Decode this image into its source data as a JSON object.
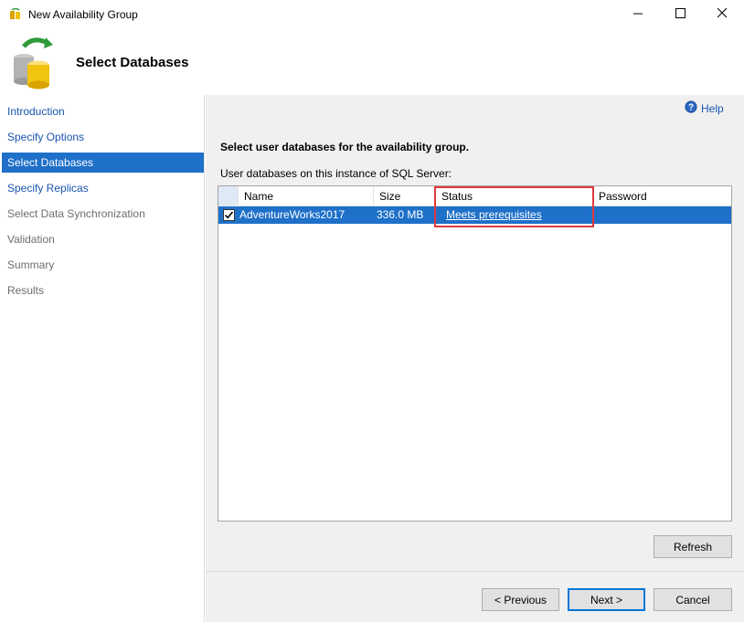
{
  "window": {
    "title": "New Availability Group",
    "controls": [
      "minimize-icon",
      "maximize-icon",
      "close-icon"
    ]
  },
  "header": {
    "title": "Select Databases",
    "icon": "database-wizard-icon"
  },
  "nav": {
    "items": [
      {
        "label": "Introduction",
        "state": "link"
      },
      {
        "label": "Specify Options",
        "state": "link"
      },
      {
        "label": "Select Databases",
        "state": "selected"
      },
      {
        "label": "Specify Replicas",
        "state": "link"
      },
      {
        "label": "Select Data Synchronization",
        "state": "disabled"
      },
      {
        "label": "Validation",
        "state": "disabled"
      },
      {
        "label": "Summary",
        "state": "disabled"
      },
      {
        "label": "Results",
        "state": "disabled"
      }
    ]
  },
  "main": {
    "help_label": "Help",
    "heading": "Select user databases for the availability group.",
    "grid_label": "User databases on this instance of SQL Server:",
    "columns": [
      "Name",
      "Size",
      "Status",
      "Password"
    ],
    "rows": [
      {
        "checked": true,
        "name": "AdventureWorks2017",
        "size": "336.0 MB",
        "status": "Meets prerequisites",
        "password": ""
      }
    ]
  },
  "buttons": {
    "refresh": "Refresh",
    "previous": "< Previous",
    "next": "Next >",
    "cancel": "Cancel"
  },
  "colors": {
    "selection": "#1e70c8",
    "link": "#1a55b0",
    "highlight_box": "#e0393e",
    "panel_bg": "#f0f0f0"
  }
}
